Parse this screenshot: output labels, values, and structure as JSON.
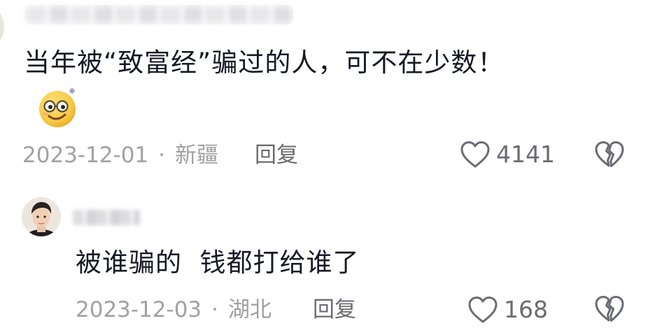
{
  "comments": [
    {
      "text": "当年被“致富经”骗过的人，可不在少数！",
      "emoji": "smiling-face-with-glasses-emoji",
      "date": "2023-12-01",
      "separator": "·",
      "location": "新疆",
      "reply_label": "回复",
      "likes": "4141"
    },
    {
      "text": "被谁骗的  钱都打给谁了",
      "date": "2023-12-03",
      "separator": "·",
      "location": "湖北",
      "reply_label": "回复",
      "likes": "168"
    }
  ],
  "icons": {
    "like": "heart-outline-icon",
    "dislike": "broken-heart-icon"
  },
  "colors": {
    "text_primary": "#161823",
    "text_meta": "#a0a0a6",
    "text_secondary": "#6b6b73",
    "emoji_yellow": "#f7c948"
  }
}
